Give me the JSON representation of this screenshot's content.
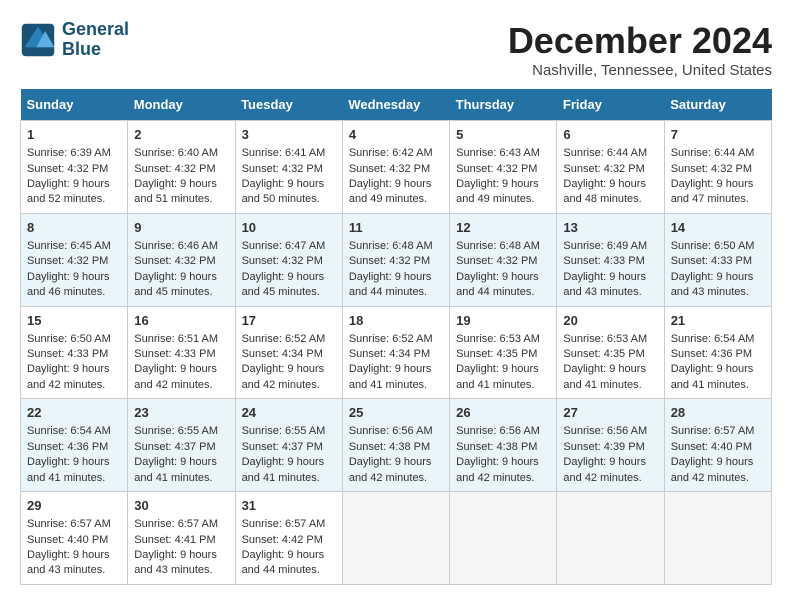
{
  "header": {
    "logo_line1": "General",
    "logo_line2": "Blue",
    "month_title": "December 2024",
    "location": "Nashville, Tennessee, United States"
  },
  "calendar": {
    "headers": [
      "Sunday",
      "Monday",
      "Tuesday",
      "Wednesday",
      "Thursday",
      "Friday",
      "Saturday"
    ],
    "weeks": [
      [
        {
          "day": "1",
          "sunrise": "6:39 AM",
          "sunset": "4:32 PM",
          "daylight": "9 hours and 52 minutes."
        },
        {
          "day": "2",
          "sunrise": "6:40 AM",
          "sunset": "4:32 PM",
          "daylight": "9 hours and 51 minutes."
        },
        {
          "day": "3",
          "sunrise": "6:41 AM",
          "sunset": "4:32 PM",
          "daylight": "9 hours and 50 minutes."
        },
        {
          "day": "4",
          "sunrise": "6:42 AM",
          "sunset": "4:32 PM",
          "daylight": "9 hours and 49 minutes."
        },
        {
          "day": "5",
          "sunrise": "6:43 AM",
          "sunset": "4:32 PM",
          "daylight": "9 hours and 49 minutes."
        },
        {
          "day": "6",
          "sunrise": "6:44 AM",
          "sunset": "4:32 PM",
          "daylight": "9 hours and 48 minutes."
        },
        {
          "day": "7",
          "sunrise": "6:44 AM",
          "sunset": "4:32 PM",
          "daylight": "9 hours and 47 minutes."
        }
      ],
      [
        {
          "day": "8",
          "sunrise": "6:45 AM",
          "sunset": "4:32 PM",
          "daylight": "9 hours and 46 minutes."
        },
        {
          "day": "9",
          "sunrise": "6:46 AM",
          "sunset": "4:32 PM",
          "daylight": "9 hours and 45 minutes."
        },
        {
          "day": "10",
          "sunrise": "6:47 AM",
          "sunset": "4:32 PM",
          "daylight": "9 hours and 45 minutes."
        },
        {
          "day": "11",
          "sunrise": "6:48 AM",
          "sunset": "4:32 PM",
          "daylight": "9 hours and 44 minutes."
        },
        {
          "day": "12",
          "sunrise": "6:48 AM",
          "sunset": "4:32 PM",
          "daylight": "9 hours and 44 minutes."
        },
        {
          "day": "13",
          "sunrise": "6:49 AM",
          "sunset": "4:33 PM",
          "daylight": "9 hours and 43 minutes."
        },
        {
          "day": "14",
          "sunrise": "6:50 AM",
          "sunset": "4:33 PM",
          "daylight": "9 hours and 43 minutes."
        }
      ],
      [
        {
          "day": "15",
          "sunrise": "6:50 AM",
          "sunset": "4:33 PM",
          "daylight": "9 hours and 42 minutes."
        },
        {
          "day": "16",
          "sunrise": "6:51 AM",
          "sunset": "4:33 PM",
          "daylight": "9 hours and 42 minutes."
        },
        {
          "day": "17",
          "sunrise": "6:52 AM",
          "sunset": "4:34 PM",
          "daylight": "9 hours and 42 minutes."
        },
        {
          "day": "18",
          "sunrise": "6:52 AM",
          "sunset": "4:34 PM",
          "daylight": "9 hours and 41 minutes."
        },
        {
          "day": "19",
          "sunrise": "6:53 AM",
          "sunset": "4:35 PM",
          "daylight": "9 hours and 41 minutes."
        },
        {
          "day": "20",
          "sunrise": "6:53 AM",
          "sunset": "4:35 PM",
          "daylight": "9 hours and 41 minutes."
        },
        {
          "day": "21",
          "sunrise": "6:54 AM",
          "sunset": "4:36 PM",
          "daylight": "9 hours and 41 minutes."
        }
      ],
      [
        {
          "day": "22",
          "sunrise": "6:54 AM",
          "sunset": "4:36 PM",
          "daylight": "9 hours and 41 minutes."
        },
        {
          "day": "23",
          "sunrise": "6:55 AM",
          "sunset": "4:37 PM",
          "daylight": "9 hours and 41 minutes."
        },
        {
          "day": "24",
          "sunrise": "6:55 AM",
          "sunset": "4:37 PM",
          "daylight": "9 hours and 41 minutes."
        },
        {
          "day": "25",
          "sunrise": "6:56 AM",
          "sunset": "4:38 PM",
          "daylight": "9 hours and 42 minutes."
        },
        {
          "day": "26",
          "sunrise": "6:56 AM",
          "sunset": "4:38 PM",
          "daylight": "9 hours and 42 minutes."
        },
        {
          "day": "27",
          "sunrise": "6:56 AM",
          "sunset": "4:39 PM",
          "daylight": "9 hours and 42 minutes."
        },
        {
          "day": "28",
          "sunrise": "6:57 AM",
          "sunset": "4:40 PM",
          "daylight": "9 hours and 42 minutes."
        }
      ],
      [
        {
          "day": "29",
          "sunrise": "6:57 AM",
          "sunset": "4:40 PM",
          "daylight": "9 hours and 43 minutes."
        },
        {
          "day": "30",
          "sunrise": "6:57 AM",
          "sunset": "4:41 PM",
          "daylight": "9 hours and 43 minutes."
        },
        {
          "day": "31",
          "sunrise": "6:57 AM",
          "sunset": "4:42 PM",
          "daylight": "9 hours and 44 minutes."
        },
        null,
        null,
        null,
        null
      ]
    ]
  }
}
